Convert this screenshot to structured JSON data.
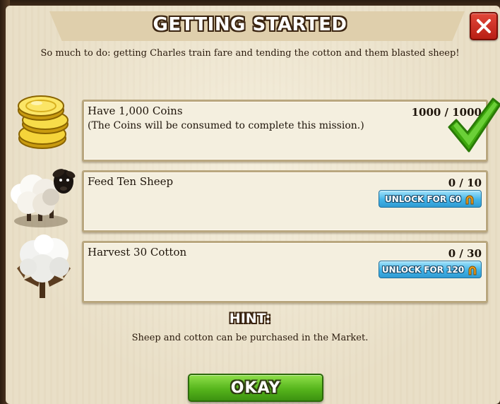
{
  "dialog": {
    "title": "GETTING STARTED",
    "subtitle": "So much to do: getting Charles train fare and tending the cotton and them blasted sheep!",
    "close_icon": "close-icon"
  },
  "tasks": [
    {
      "label": "Have 1,000 Coins",
      "note": "(The Coins will be consumed to complete this mission.)",
      "progress": "1000 / 1000",
      "icon": "coins-icon",
      "complete": true,
      "status_icon": "checkmark-icon"
    },
    {
      "label": "Feed Ten Sheep",
      "progress": "0 / 10",
      "icon": "sheep-icon",
      "complete": false,
      "unlock_label": "UNLOCK FOR 60",
      "unlock_icon": "horseshoe-icon"
    },
    {
      "label": "Harvest 30 Cotton",
      "progress": "0 / 30",
      "icon": "cotton-icon",
      "complete": false,
      "unlock_label": "UNLOCK FOR 120",
      "unlock_icon": "horseshoe-icon"
    }
  ],
  "hint": {
    "title": "HINT:",
    "text": "Sheep and cotton can be purchased in the Market."
  },
  "okay_label": "OKAY",
  "colors": {
    "parchment": "#e9dfc7",
    "close_red": "#d0342a",
    "unlock_blue": "#42b4e8",
    "okay_green": "#56b51c",
    "check_green": "#4cc21a",
    "frame_brown": "#3d2a18"
  }
}
